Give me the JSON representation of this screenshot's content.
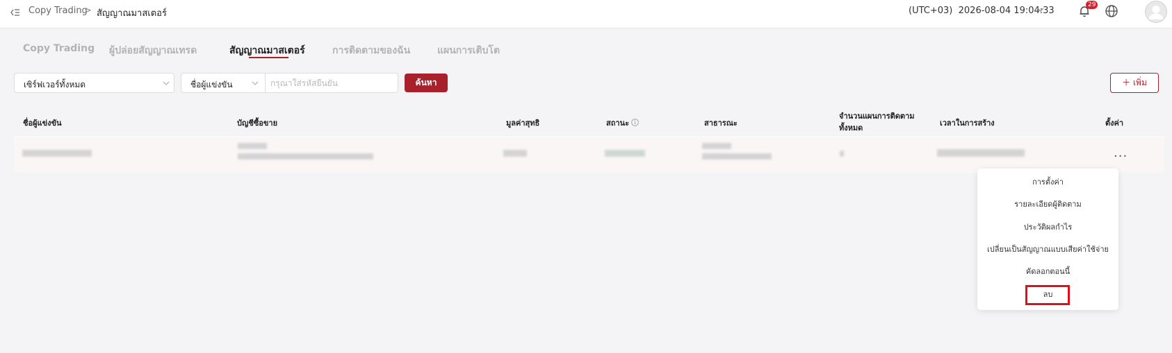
{
  "header": {
    "breadcrumb_root": "Copy Trading",
    "breadcrumb_separator": ">",
    "breadcrumb_current": "สัญญาณมาสเตอร์",
    "timezone": "(UTC+03)",
    "datetime": "2026-08-04 19:04:33",
    "notification_count": "29"
  },
  "tabs": [
    {
      "label": "Copy Trading",
      "active": false
    },
    {
      "label": "ผู้ปล่อยสัญญาณเทรด",
      "active": false
    },
    {
      "label": "สัญญาณมาสเตอร์",
      "active": true
    },
    {
      "label": "การติดตามของฉัน",
      "active": false
    },
    {
      "label": "แผนการเติบโต",
      "active": false
    }
  ],
  "filters": {
    "server_select": "เซิร์ฟเวอร์ทั้งหมด",
    "field_select": "ชื่อผู้แข่งขัน",
    "search_placeholder": "กรุณาใส่รหัสยืนยัน",
    "search_button": "ค้นหา",
    "add_button": "เพิ่ม"
  },
  "table": {
    "columns": [
      "ชื่อผู้แข่งขัน",
      "บัญชีซื้อขาย",
      "มูลค่าสุทธิ",
      "สถานะ",
      "สาธารณะ",
      "จำนวนแผนการติดตามทั้งหมด",
      "เวลาในการสร้าง",
      "ตั้งค่า"
    ],
    "row_actions": "..."
  },
  "menu": {
    "items": [
      "การตั้งค่า",
      "รายละเอียดผู้ติดตาม",
      "ประวัติผลกำไร",
      "เปลี่ยนเป็นสัญญาณแบบเสียค่าใช้จ่าย",
      "คัดลอกตอนนี้",
      "ลบ"
    ],
    "highlighted": "ลบ"
  },
  "colors": {
    "accent": "#a8202b",
    "badge": "#d81e2c",
    "highlight": "#e0101a"
  },
  "icons": [
    "collapse-menu-icon",
    "chevron-down-icon",
    "bell-icon",
    "globe-icon",
    "avatar-icon",
    "info-icon",
    "plus-icon",
    "more-icon"
  ]
}
